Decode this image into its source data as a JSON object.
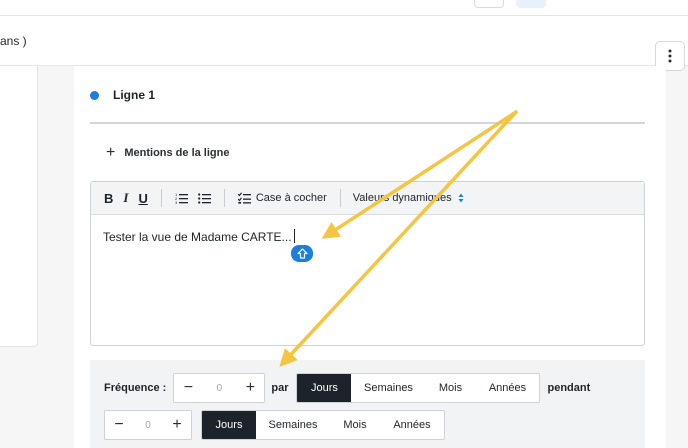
{
  "subheader": {
    "crumb": "ans )"
  },
  "line": {
    "title": "Ligne 1"
  },
  "mentions": {
    "label": "Mentions de la ligne"
  },
  "toolbar": {
    "bold": "B",
    "italic": "I",
    "underline": "U",
    "checkbox_label": "Case à cocher",
    "dynamic_label": "Valeurs dynamiques"
  },
  "editor": {
    "text": "Tester la vue de Madame CARTE..."
  },
  "frequency": {
    "label": "Fréquence :",
    "value": "0",
    "par_label": "par",
    "units": [
      "Jours",
      "Semaines",
      "Mois",
      "Années"
    ],
    "selected": "Jours",
    "pendant_label": "pendant"
  },
  "duration": {
    "value": "0",
    "units": [
      "Jours",
      "Semaines",
      "Mois",
      "Années"
    ],
    "selected": "Jours"
  },
  "colors": {
    "accent": "#1c80d9",
    "annotation_arrow": "#f5c542",
    "segment_active": "#1d232b"
  }
}
